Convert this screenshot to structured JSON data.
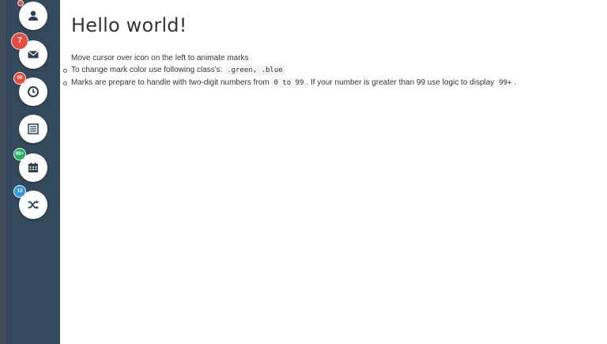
{
  "sidebar": {
    "items": [
      {
        "icon": "user-icon",
        "mark": {
          "text": "",
          "color": "#e74c3c"
        }
      },
      {
        "icon": "envelope-icon",
        "mark": {
          "text": "7",
          "color": "#e74c3c"
        }
      },
      {
        "icon": "clock-icon",
        "mark": {
          "text": "99",
          "color": "#e74c3c"
        }
      },
      {
        "icon": "list-icon",
        "mark": null
      },
      {
        "icon": "calendar-icon",
        "mark": {
          "text": "99+",
          "color": "#27ae60"
        }
      },
      {
        "icon": "shuffle-icon",
        "mark": {
          "text": "13",
          "color": "#3498db"
        }
      }
    ]
  },
  "main": {
    "title": "Hello world!",
    "intro": "Move cursor over icon on the left to animate marks",
    "bullet1_text": "To change mark color use following class's: ",
    "bullet1_code": ".green, .blue",
    "bullet2_text_a": "Marks are prepare to handle with two-digit numbers from ",
    "bullet2_code_a": "0 to 99",
    "bullet2_text_b": ". If your number is greater than 99 use logic to display ",
    "bullet2_code_b": "99+",
    "bullet2_text_c": "."
  }
}
